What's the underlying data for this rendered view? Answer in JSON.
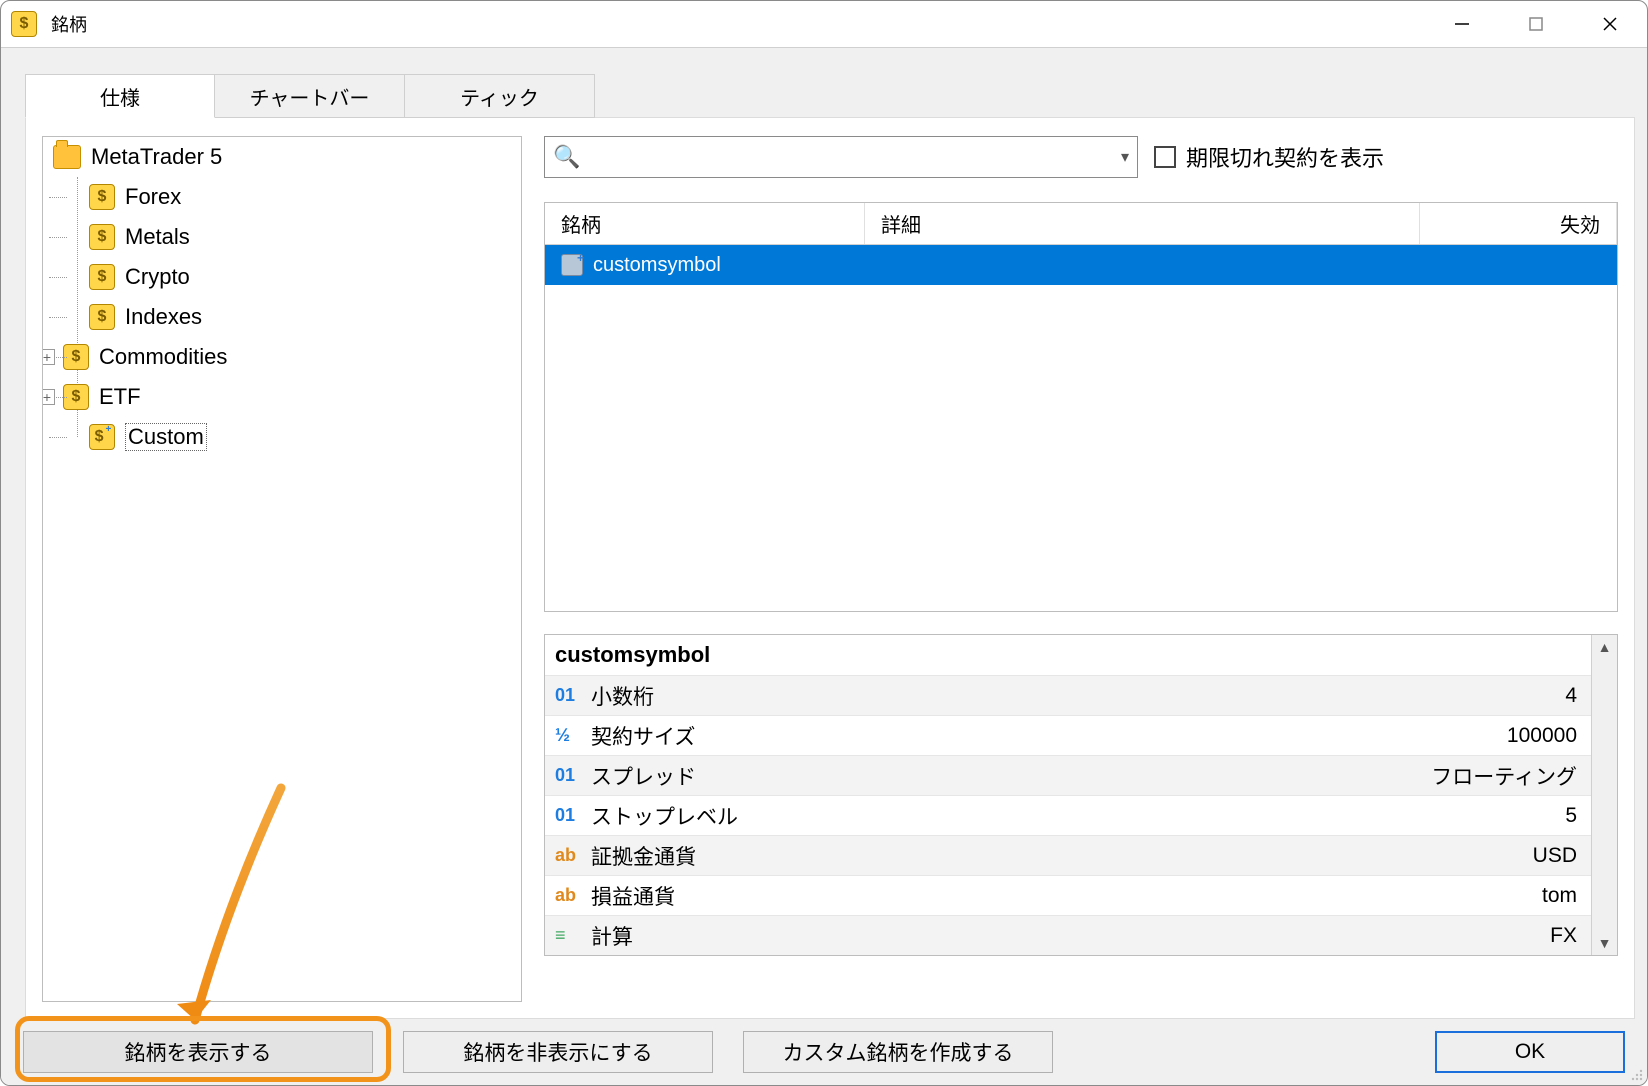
{
  "window": {
    "title": "銘柄"
  },
  "tabs": {
    "spec": "仕様",
    "chartbar": "チャートバー",
    "tick": "ティック",
    "active": "spec"
  },
  "tree": {
    "root": "MetaTrader 5",
    "items": [
      {
        "label": "Forex",
        "expandable": false
      },
      {
        "label": "Metals",
        "expandable": false
      },
      {
        "label": "Crypto",
        "expandable": false
      },
      {
        "label": "Indexes",
        "expandable": false
      },
      {
        "label": "Commodities",
        "expandable": true
      },
      {
        "label": "ETF",
        "expandable": true
      },
      {
        "label": "Custom",
        "expandable": false,
        "selected": true,
        "customIcon": true
      }
    ]
  },
  "search": {
    "placeholder": ""
  },
  "expired_check": {
    "label": "期限切れ契約を表示",
    "checked": false
  },
  "grid": {
    "columns": {
      "symbol": "銘柄",
      "detail": "詳細",
      "invalid": "失効"
    },
    "rows": [
      {
        "symbol": "customsymbol",
        "detail": "",
        "invalid": "",
        "selected": true
      }
    ]
  },
  "details": {
    "title": "customsymbol",
    "props": [
      {
        "icon": "01",
        "iconClass": "k-01",
        "key": "小数桁",
        "value": "4",
        "alt": true
      },
      {
        "icon": "½",
        "iconClass": "k-half",
        "key": "契約サイズ",
        "value": "100000",
        "alt": false
      },
      {
        "icon": "01",
        "iconClass": "k-01",
        "key": "スプレッド",
        "value": "フローティング",
        "alt": true
      },
      {
        "icon": "01",
        "iconClass": "k-01",
        "key": "ストップレベル",
        "value": "5",
        "alt": false
      },
      {
        "icon": "ab",
        "iconClass": "k-ab",
        "key": "証拠金通貨",
        "value": "USD",
        "alt": true
      },
      {
        "icon": "ab",
        "iconClass": "k-ab",
        "key": "損益通貨",
        "value": "tom",
        "alt": false
      },
      {
        "icon": "≡",
        "iconClass": "k-calc",
        "key": "計算",
        "value": "FX",
        "alt": true
      }
    ]
  },
  "footer": {
    "show": "銘柄を表示する",
    "hide": "銘柄を非表示にする",
    "create": "カスタム銘柄を作成する",
    "ok": "OK"
  }
}
